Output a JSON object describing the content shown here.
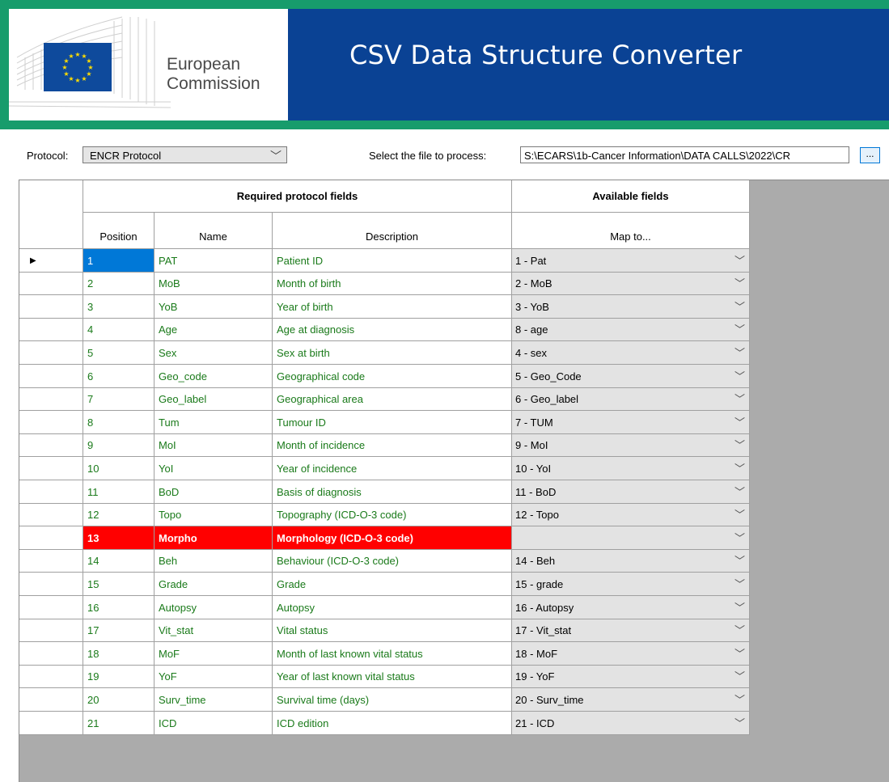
{
  "header": {
    "org_line1": "European",
    "org_line2": "Commission",
    "app_title": "CSV Data Structure Converter"
  },
  "toolbar": {
    "protocol_label": "Protocol:",
    "protocol_value": "ENCR Protocol",
    "file_label": "Select the file to process:",
    "file_path": "S:\\ECARS\\1b-Cancer Information\\DATA CALLS\\2022\\CR",
    "browse_label": "..."
  },
  "grid": {
    "group_required": "Required protocol fields",
    "group_available": "Available fields",
    "col_position": "Position",
    "col_name": "Name",
    "col_description": "Description",
    "col_map": "Map to...",
    "rows": [
      {
        "position": "1",
        "name": "PAT",
        "description": "Patient ID",
        "map": "1 - Pat"
      },
      {
        "position": "2",
        "name": "MoB",
        "description": "Month of birth",
        "map": "2 - MoB"
      },
      {
        "position": "3",
        "name": "YoB",
        "description": "Year of birth",
        "map": "3 - YoB"
      },
      {
        "position": "4",
        "name": "Age",
        "description": "Age at diagnosis",
        "map": "8 - age"
      },
      {
        "position": "5",
        "name": "Sex",
        "description": "Sex at birth",
        "map": "4 - sex"
      },
      {
        "position": "6",
        "name": "Geo_code",
        "description": "Geographical code",
        "map": "5 - Geo_Code"
      },
      {
        "position": "7",
        "name": "Geo_label",
        "description": "Geographical area",
        "map": "6 - Geo_label"
      },
      {
        "position": "8",
        "name": "Tum",
        "description": "Tumour ID",
        "map": "7 - TUM"
      },
      {
        "position": "9",
        "name": "MoI",
        "description": "Month of incidence",
        "map": "9 - MoI"
      },
      {
        "position": "10",
        "name": "YoI",
        "description": "Year of incidence",
        "map": "10 - YoI"
      },
      {
        "position": "11",
        "name": "BoD",
        "description": "Basis of diagnosis",
        "map": "11 - BoD"
      },
      {
        "position": "12",
        "name": "Topo",
        "description": "Topography (ICD-O-3 code)",
        "map": "12 - Topo"
      },
      {
        "position": "13",
        "name": "Morpho",
        "description": "Morphology (ICD-O-3 code)",
        "map": ""
      },
      {
        "position": "14",
        "name": "Beh",
        "description": "Behaviour (ICD-O-3  code)",
        "map": "14 - Beh"
      },
      {
        "position": "15",
        "name": "Grade",
        "description": "Grade",
        "map": "15 - grade"
      },
      {
        "position": "16",
        "name": "Autopsy",
        "description": "Autopsy",
        "map": "16 - Autopsy"
      },
      {
        "position": "17",
        "name": "Vit_stat",
        "description": "Vital status",
        "map": "17 - Vit_stat"
      },
      {
        "position": "18",
        "name": "MoF",
        "description": "Month of last known vital status",
        "map": "18 - MoF"
      },
      {
        "position": "19",
        "name": "YoF",
        "description": "Year of last known vital status",
        "map": "19 - YoF"
      },
      {
        "position": "20",
        "name": "Surv_time",
        "description": "Survival time (days)",
        "map": "20 - Surv_time"
      },
      {
        "position": "21",
        "name": "ICD",
        "description": "ICD edition",
        "map": "21 - ICD"
      }
    ]
  },
  "colors": {
    "banner_green": "#179c6c",
    "banner_blue": "#0a4294",
    "text_green": "#1a7a1a",
    "error_red": "#ff0000",
    "selected_blue": "#0078d7"
  }
}
